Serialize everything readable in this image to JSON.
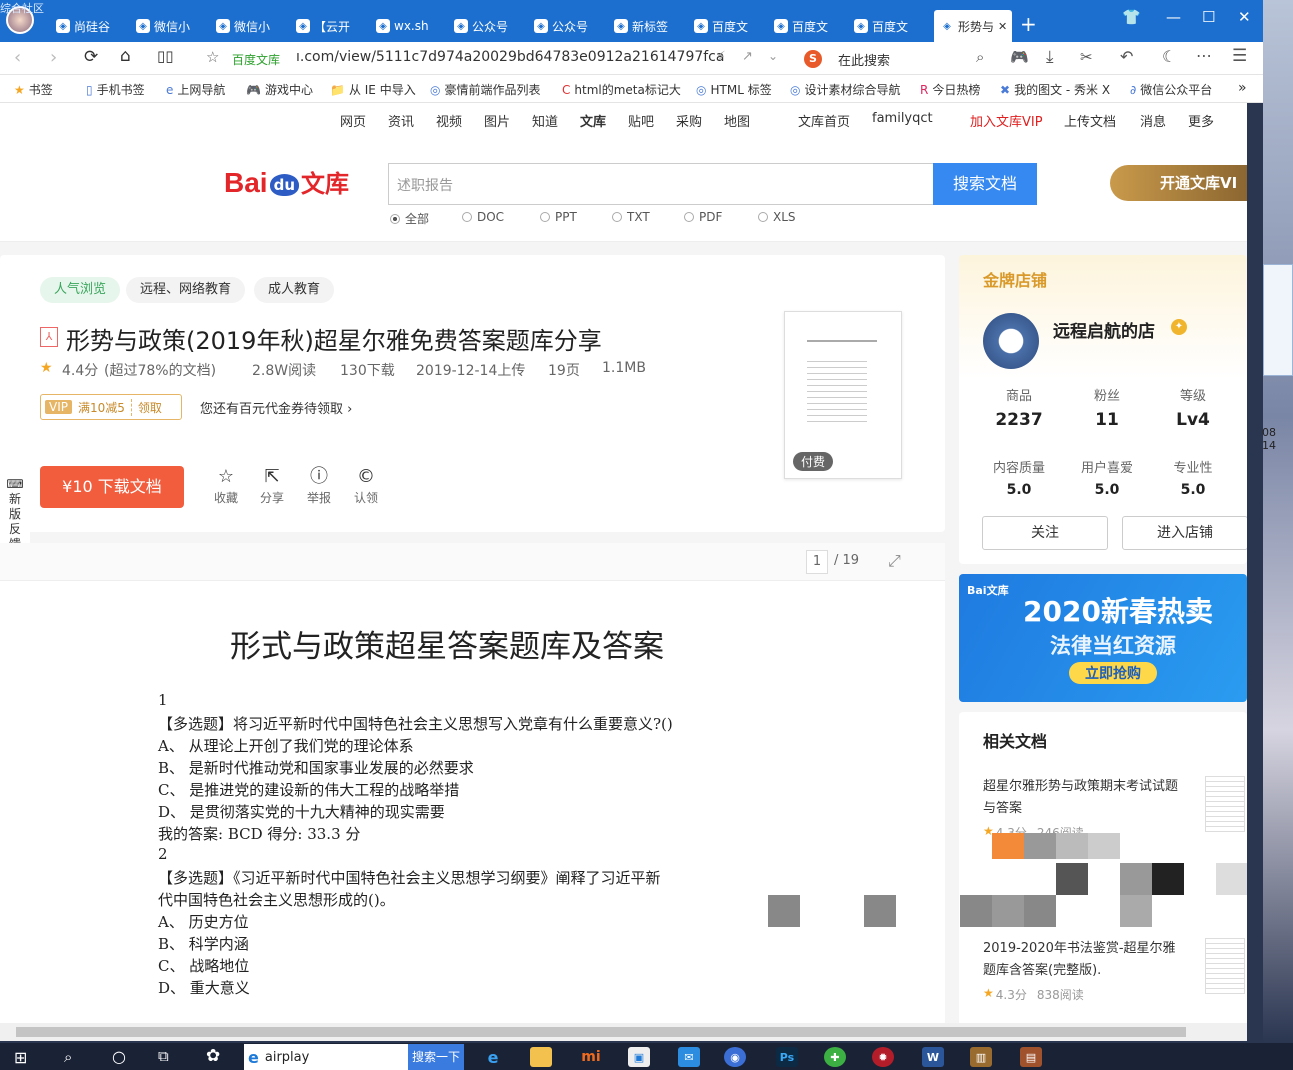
{
  "browser": {
    "overlay_title": "综合社区",
    "tabs": [
      "尚硅谷",
      "微信小",
      "微信小",
      "【云开",
      "wx.sh",
      "公众号",
      "公众号",
      "新标签",
      "百度文",
      "百度文",
      "百度文",
      "形势与"
    ],
    "new_tab": "+",
    "window_controls": {
      "shirt": "👕",
      "minimize": "—",
      "maximize": "☐",
      "close": "✕"
    },
    "address": {
      "site_label": "百度文库",
      "url": "ı.com/view/5111c7d974a20029bd64783e0912a21614797fca",
      "search_engine": "S",
      "search_placeholder": "在此搜索"
    },
    "bookmarks": [
      "书签",
      "手机书签",
      "上网导航",
      "游戏中心",
      "从 IE 中导入",
      "豪情前端作品列表",
      "html的meta标记大",
      "HTML 标签",
      "设计素材综合导航",
      "今日热榜",
      "我的图文 - 秀米 X",
      "微信公众平台"
    ],
    "bookmarks_more": "»"
  },
  "topnav": {
    "items": [
      "网页",
      "资讯",
      "视频",
      "图片",
      "知道",
      "文库",
      "贴吧",
      "采购",
      "地图"
    ],
    "right": [
      "文库首页",
      "familyqct",
      "加入文库VIP",
      "上传文档",
      "消息",
      "更多"
    ]
  },
  "header": {
    "logo_bai": "Bai",
    "logo_du": "du",
    "logo_wenku": "文库",
    "search_placeholder": "述职报告",
    "search_button": "搜索文档",
    "filters": [
      "全部",
      "DOC",
      "PPT",
      "TXT",
      "PDF",
      "XLS"
    ],
    "vip_banner": "开通文库VI"
  },
  "doc": {
    "tags": [
      "人气浏览",
      "远程、网络教育",
      "成人教育"
    ],
    "title": "形势与政策(2019年秋)超星尔雅免费答案题库分享",
    "rating": "4.4分",
    "rating_note": "(超过78%的文档)",
    "reads": "2.8W阅读",
    "downloads": "130下载",
    "upload_date": "2019-12-14上传",
    "pages": "19页",
    "size": "1.1MB",
    "vip_label": "VIP",
    "coupon": "满10减5",
    "coupon_claim": "领取",
    "coupon_note": "您还有百元代金券待领取",
    "download_button": "¥10 下载文档",
    "actions": [
      "收藏",
      "分享",
      "举报",
      "认领"
    ],
    "thumb_badge": "付费",
    "feedback": "新版反馈"
  },
  "reader": {
    "page_current": "1",
    "page_total": "/ 19",
    "doc_title": "形式与政策超星答案题库及答案",
    "lines": [
      "1",
      "【多选题】将习近平新时代中国特色社会主义思想写入党章有什么重要意义?()",
      "A、  从理论上开创了我们党的理论体系",
      "B、  是新时代推动党和国家事业发展的必然要求",
      "C、  是推进党的建设新的伟大工程的战略举措",
      "D、  是贯彻落实党的十九大精神的现实需要",
      "我的答案: BCD 得分:  33.3 分",
      "2",
      "【多选题】《习近平新时代中国特色社会主义思想学习纲要》阐释了习近平新",
      "代中国特色社会主义思想形成的()。",
      "A、  历史方位",
      "B、  科学内涵",
      "C、  战略地位",
      "D、  重大意义"
    ]
  },
  "shop": {
    "heading": "金牌店铺",
    "name": "远程启航的店",
    "stats": [
      {
        "label": "商品",
        "value": "2237"
      },
      {
        "label": "粉丝",
        "value": "11"
      },
      {
        "label": "等级",
        "value": "Lv4"
      }
    ],
    "scores": [
      {
        "label": "内容质量",
        "value": "5.0"
      },
      {
        "label": "用户喜爱",
        "value": "5.0"
      },
      {
        "label": "专业性",
        "value": "5.0"
      }
    ],
    "follow_button": "关注",
    "enter_button": "进入店铺"
  },
  "promo": {
    "brand": "Bai文库",
    "line1": "2020新春热卖",
    "line2": "法律当红资源",
    "cta": "立即抢购"
  },
  "related": {
    "heading": "相关文档",
    "items": [
      {
        "title": "超星尔雅形势与政策期末考试试题与答案",
        "rating": "4.3分",
        "reads": "246阅读"
      },
      {
        "title": "2019-2020年书法鉴赏-超星尔雅题库含答案(完整版).",
        "rating": "4.3分",
        "reads": "838阅读"
      }
    ]
  },
  "desktop": {
    "time_fragment": "08 14"
  },
  "taskbar": {
    "search_text": "airplay",
    "search_button": "搜索一下"
  },
  "colors": {
    "accent": "#2f7cf6",
    "download": "#f25d3e",
    "vip_red": "#e02020",
    "tab_bar": "#1c6fce"
  }
}
